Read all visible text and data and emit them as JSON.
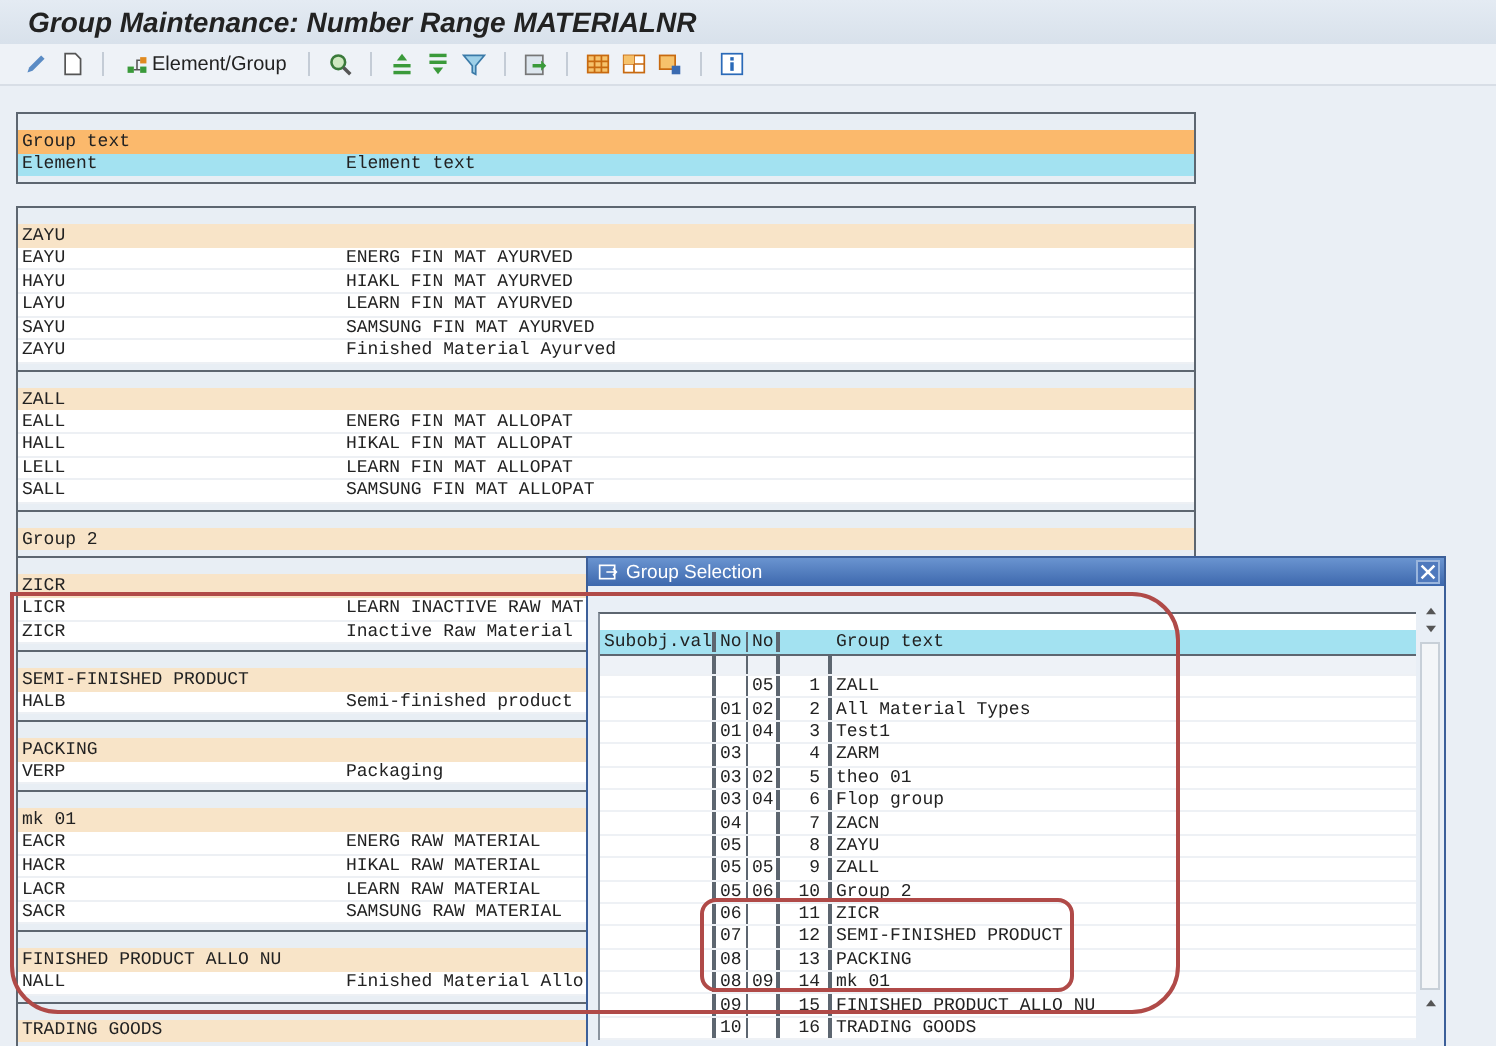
{
  "window": {
    "title": "Group Maintenance: Number Range MATERIALNR"
  },
  "toolbar": {
    "button_label": "Element/Group"
  },
  "list": {
    "header": {
      "group_text": "Group text",
      "element": "Element",
      "element_text": "Element text"
    },
    "groups": [
      {
        "name": "ZAYU",
        "elements": [
          {
            "element": "EAYU",
            "text": "ENERG FIN MAT AYURVED"
          },
          {
            "element": "HAYU",
            "text": "HIAKL FIN MAT AYURVED"
          },
          {
            "element": "LAYU",
            "text": "LEARN FIN MAT AYURVED"
          },
          {
            "element": "SAYU",
            "text": "SAMSUNG FIN MAT AYURVED"
          },
          {
            "element": "ZAYU",
            "text": "Finished Material Ayurved"
          }
        ]
      },
      {
        "name": "ZALL",
        "elements": [
          {
            "element": "EALL",
            "text": "ENERG FIN MAT ALLOPAT"
          },
          {
            "element": "HALL",
            "text": "HIKAL FIN MAT ALLOPAT"
          },
          {
            "element": "LELL",
            "text": "LEARN FIN MAT ALLOPAT"
          },
          {
            "element": "SALL",
            "text": "SAMSUNG FIN MAT ALLOPAT"
          }
        ]
      },
      {
        "name": "Group 2"
      },
      {
        "name": "ZICR",
        "elements": [
          {
            "element": "LICR",
            "text": "LEARN INACTIVE RAW MAT"
          },
          {
            "element": "ZICR",
            "text": "Inactive Raw Material"
          }
        ]
      },
      {
        "name": "SEMI-FINISHED PRODUCT",
        "elements": [
          {
            "element": "HALB",
            "text": "Semi-finished product"
          }
        ]
      },
      {
        "name": "PACKING",
        "elements": [
          {
            "element": "VERP",
            "text": "Packaging"
          }
        ]
      },
      {
        "name": "mk 01",
        "elements": [
          {
            "element": "EACR",
            "text": "ENERG RAW MATERIAL"
          },
          {
            "element": "HACR",
            "text": "HIKAL RAW MATERIAL"
          },
          {
            "element": "LACR",
            "text": "LEARN RAW MATERIAL"
          },
          {
            "element": "SACR",
            "text": "SAMSUNG RAW MATERIAL"
          }
        ]
      },
      {
        "name": "FINISHED PRODUCT ALLO NU",
        "elements": [
          {
            "element": "NALL",
            "text": "Finished Material Allo"
          }
        ]
      },
      {
        "name": "TRADING GOODS"
      }
    ]
  },
  "dialog": {
    "title": "Group Selection",
    "header": {
      "subobj_val": "Subobj.val",
      "no_1": "No",
      "no_2": "No",
      "group_text": "Group text"
    },
    "rows": [
      {
        "no_2": "05",
        "column_4": "1",
        "group_text": "ZALL"
      },
      {
        "no_1": "01",
        "no_2": "02",
        "column_4": "2",
        "group_text": "All Material Types"
      },
      {
        "no_1": "01",
        "no_2": "04",
        "column_4": "3",
        "group_text": "Test1"
      },
      {
        "no_1": "03",
        "column_4": "4",
        "group_text": "ZARM"
      },
      {
        "no_1": "03",
        "no_2": "02",
        "column_4": "5",
        "group_text": "theo 01"
      },
      {
        "no_1": "03",
        "no_2": "04",
        "column_4": "6",
        "group_text": "Flop group"
      },
      {
        "no_1": "04",
        "column_4": "7",
        "group_text": "ZACN"
      },
      {
        "no_1": "05",
        "column_4": "8",
        "group_text": "ZAYU"
      },
      {
        "no_1": "05",
        "no_2": "05",
        "column_4": "9",
        "group_text": "ZALL"
      },
      {
        "no_1": "05",
        "no_2": "06",
        "column_4": "10",
        "group_text": "Group 2"
      },
      {
        "no_1": "06",
        "column_4": "11",
        "group_text": "ZICR"
      },
      {
        "no_1": "07",
        "column_4": "12",
        "group_text": "SEMI-FINISHED PRODUCT"
      },
      {
        "no_1": "08",
        "column_4": "13",
        "group_text": "PACKING"
      },
      {
        "no_1": "08",
        "no_2": "09",
        "column_4": "14",
        "group_text": "mk 01"
      },
      {
        "no_1": "09",
        "column_4": "15",
        "group_text": "FINISHED PRODUCT ALLO NU"
      },
      {
        "no_1": "10",
        "column_4": "16",
        "group_text": "TRADING GOODS"
      }
    ]
  }
}
